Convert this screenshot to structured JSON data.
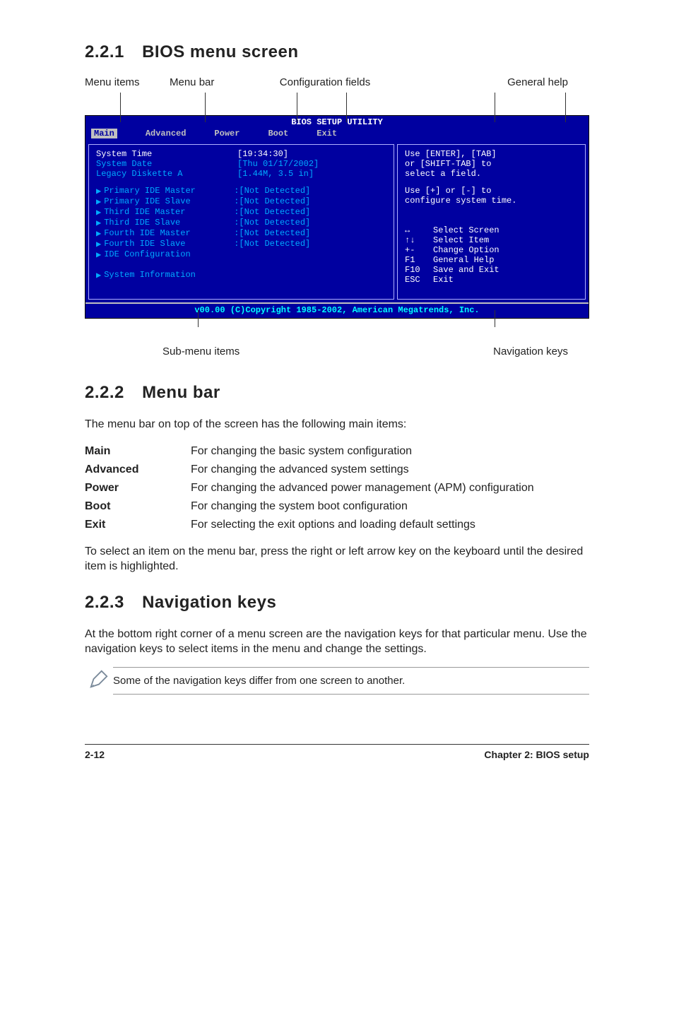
{
  "sections": {
    "s1": {
      "num": "2.2.1",
      "title": "BIOS menu screen"
    },
    "s2": {
      "num": "2.2.2",
      "title": "Menu bar"
    },
    "s3": {
      "num": "2.2.3",
      "title": "Navigation keys"
    }
  },
  "annot": {
    "menu_items": "Menu items",
    "menu_bar": "Menu bar",
    "config_fields": "Configuration fields",
    "general_help": "General help",
    "submenu": "Sub-menu items",
    "navkeys": "Navigation keys"
  },
  "bios": {
    "title": "BIOS SETUP UTILITY",
    "menubar": [
      "Main",
      "Advanced",
      "Power",
      "Boot",
      "Exit"
    ],
    "main_rows": [
      {
        "label": "System Time",
        "value": "[19:34:30]",
        "sel": true
      },
      {
        "label": "System Date",
        "value": "[Thu 01/17/2002]",
        "sel": false
      },
      {
        "label": "Legacy Diskette A",
        "value": "[1.44M, 3.5 in]",
        "sel": false
      }
    ],
    "ide_rows": [
      {
        "label": "Primary IDE Master",
        "value": ":[Not Detected]"
      },
      {
        "label": "Primary IDE Slave",
        "value": ":[Not Detected]"
      },
      {
        "label": "Third IDE Master",
        "value": ":[Not Detected]"
      },
      {
        "label": "Third IDE Slave",
        "value": ":[Not Detected]"
      },
      {
        "label": "Fourth IDE Master",
        "value": ":[Not Detected]"
      },
      {
        "label": "Fourth IDE Slave",
        "value": ":[Not Detected]"
      },
      {
        "label": "IDE Configuration",
        "value": ""
      }
    ],
    "sysinfo": "System Information",
    "help": {
      "l1": "Use [ENTER], [TAB]",
      "l2": "or [SHIFT-TAB] to",
      "l3": "select a field.",
      "l4": "Use [+] or [-] to",
      "l5": "configure system time."
    },
    "nav": [
      {
        "key": "↔",
        "desc": "Select Screen"
      },
      {
        "key": "↑↓",
        "desc": "Select Item"
      },
      {
        "key": "+-",
        "desc": "Change Option"
      },
      {
        "key": "F1",
        "desc": "General Help"
      },
      {
        "key": "F10",
        "desc": "Save and Exit"
      },
      {
        "key": "ESC",
        "desc": "Exit"
      }
    ],
    "footer": "v00.00 (C)Copyright 1985-2002, American Megatrends, Inc."
  },
  "menubar_intro": "The menu bar on top of the screen has the following main items:",
  "menubar_items": [
    {
      "name": "Main",
      "desc": "For changing the basic system configuration"
    },
    {
      "name": "Advanced",
      "desc": "For changing the advanced system settings"
    },
    {
      "name": "Power",
      "desc": "For changing the advanced power management (APM) configuration"
    },
    {
      "name": "Boot",
      "desc": "For changing the system boot configuration"
    },
    {
      "name": "Exit",
      "desc": "For selecting the exit options and loading default settings"
    }
  ],
  "menubar_hint": "To select an item on the menu bar, press the right or left arrow key on the keyboard until the desired item is highlighted.",
  "navkeys_para": "At the bottom right corner of a menu screen are the navigation keys for that particular menu. Use the navigation keys to select items in the menu and change the settings.",
  "note": "Some of the navigation keys differ from one screen to another.",
  "footer": {
    "page": "2-12",
    "chapter": "Chapter 2: BIOS setup"
  }
}
